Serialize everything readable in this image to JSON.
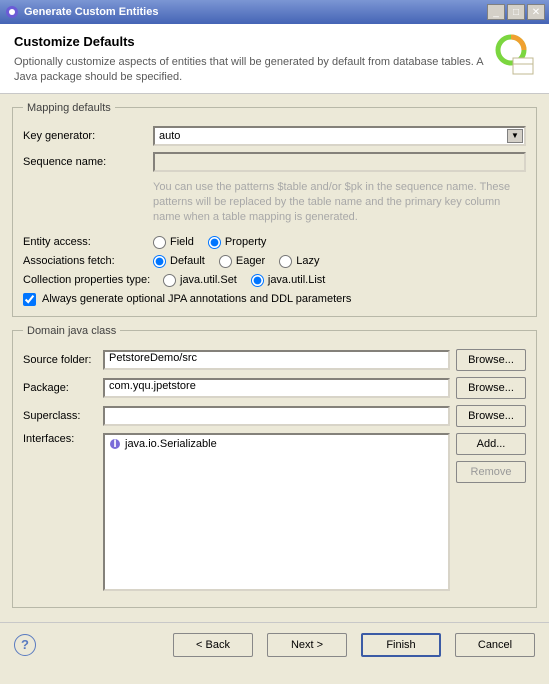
{
  "window": {
    "title": "Generate Custom Entities"
  },
  "header": {
    "title": "Customize Defaults",
    "desc": "Optionally customize aspects of entities that will be generated by default from database tables. A Java package should be specified."
  },
  "mapping": {
    "legend": "Mapping defaults",
    "keygen_label": "Key generator:",
    "keygen_value": "auto",
    "seqname_label": "Sequence name:",
    "seqname_value": "",
    "hint": "You can use the patterns $table and/or $pk in the sequence name. These patterns will be replaced by the table name and the primary key column name when a table mapping is generated.",
    "entity_access_label": "Entity access:",
    "access_field": "Field",
    "access_property": "Property",
    "assoc_fetch_label": "Associations fetch:",
    "fetch_default": "Default",
    "fetch_eager": "Eager",
    "fetch_lazy": "Lazy",
    "coll_type_label": "Collection properties type:",
    "coll_set": "java.util.Set",
    "coll_list": "java.util.List",
    "chk_label": "Always generate optional JPA annotations and DDL parameters"
  },
  "domain": {
    "legend": "Domain java class",
    "src_label": "Source folder:",
    "src_value": "PetstoreDemo/src",
    "pkg_label": "Package:",
    "pkg_value": "com.yqu.jpetstore",
    "super_label": "Superclass:",
    "super_value": "",
    "ifaces_label": "Interfaces:",
    "iface0": "java.io.Serializable",
    "browse": "Browse...",
    "add": "Add...",
    "remove": "Remove"
  },
  "footer": {
    "back": "< Back",
    "next": "Next >",
    "finish": "Finish",
    "cancel": "Cancel"
  }
}
